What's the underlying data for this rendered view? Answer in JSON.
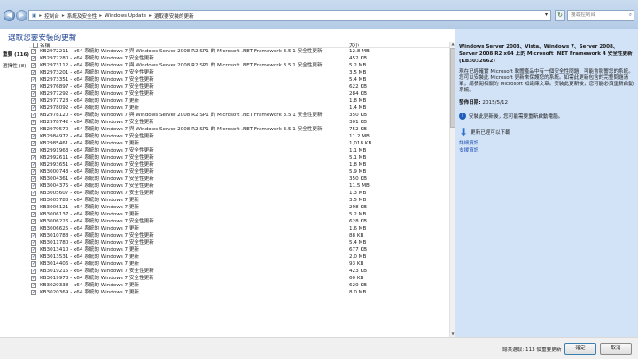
{
  "address": {
    "crumbs": [
      "控制台",
      "系統及安全性",
      "Windows Update",
      "選取要安裝的更新"
    ],
    "right_text": "",
    "search_placeholder": "搜尋控制台"
  },
  "heading": "選取您要安裝的更新",
  "categories": [
    {
      "label": "重要 (116)",
      "selected": true
    },
    {
      "label": "選擇性 (8)",
      "selected": false
    }
  ],
  "list": {
    "col_name": "名稱",
    "col_size": "大小",
    "rows": [
      {
        "name": "KB2972211 - x64 系統的 Windows 7 與 Windows Server 2008 R2 SP1 的 Microsoft .NET Framework 3.5.1 安全性更新",
        "size": "12.8 MB"
      },
      {
        "name": "KB2972280 - x64 系統的 Windows 7 安全性更新",
        "size": "452 KB"
      },
      {
        "name": "KB2973112 - x64 系統的 Windows 7 與 Windows Server 2008 R2 SP1 的 Microsoft .NET Framework 3.5.1 安全性更新",
        "size": "5.2 MB"
      },
      {
        "name": "KB2973201 - x64 系統的 Windows 7 安全性更新",
        "size": "3.5 MB"
      },
      {
        "name": "KB2973351 - x64 系統的 Windows 7 安全性更新",
        "size": "5.4 MB"
      },
      {
        "name": "KB2976897 - x64 系統的 Windows 7 安全性更新",
        "size": "622 KB"
      },
      {
        "name": "KB2977292 - x64 系統的 Windows 7 安全性更新",
        "size": "284 KB"
      },
      {
        "name": "KB2977728 - x64 系統的 Windows 7 更新",
        "size": "1.8 MB"
      },
      {
        "name": "KB2978092 - x64 系統的 Windows 7 更新",
        "size": "1.4 MB"
      },
      {
        "name": "KB2978120 - x64 系統的 Windows 7 與 Windows Server 2008 R2 SP1 的 Microsoft .NET Framework 3.5.1 安全性更新",
        "size": "350 KB"
      },
      {
        "name": "KB2978742 - x64 系統的 Windows 7 安全性更新",
        "size": "301 KB"
      },
      {
        "name": "KB2979570 - x64 系統的 Windows 7 與 Windows Server 2008 R2 SP1 的 Microsoft .NET Framework 3.5.1 安全性更新",
        "size": "752 KB"
      },
      {
        "name": "KB2984972 - x64 系統的 Windows 7 安全性更新",
        "size": "11.2 MB"
      },
      {
        "name": "KB2985461 - x64 系統的 Windows 7 更新",
        "size": "1,018 KB"
      },
      {
        "name": "KB2991963 - x64 系統的 Windows 7 安全性更新",
        "size": "1.1 MB"
      },
      {
        "name": "KB2992611 - x64 系統的 Windows 7 安全性更新",
        "size": "5.1 MB"
      },
      {
        "name": "KB2993651 - x64 系統的 Windows 7 安全性更新",
        "size": "1.8 MB"
      },
      {
        "name": "KB3000743 - x64 系統的 Windows 7 安全性更新",
        "size": "5.9 MB"
      },
      {
        "name": "KB3004361 - x64 系統的 Windows 7 安全性更新",
        "size": "350 KB"
      },
      {
        "name": "KB3004375 - x64 系統的 Windows 7 安全性更新",
        "size": "11.5 MB"
      },
      {
        "name": "KB3005607 - x64 系統的 Windows 7 安全性更新",
        "size": "1.3 MB"
      },
      {
        "name": "KB3005788 - x64 系統的 Windows 7 更新",
        "size": "3.5 MB"
      },
      {
        "name": "KB3006121 - x64 系統的 Windows 7 更新",
        "size": "298 KB"
      },
      {
        "name": "KB3006137 - x64 系統的 Windows 7 更新",
        "size": "5.2 MB"
      },
      {
        "name": "KB3006226 - x64 系統的 Windows 7 安全性更新",
        "size": "628 KB"
      },
      {
        "name": "KB3006625 - x64 系統的 Windows 7 更新",
        "size": "1.6 MB"
      },
      {
        "name": "KB3010788 - x64 系統的 Windows 7 安全性更新",
        "size": "88 KB"
      },
      {
        "name": "KB3011780 - x64 系統的 Windows 7 安全性更新",
        "size": "5.4 MB"
      },
      {
        "name": "KB3013410 - x64 系統的 Windows 7 更新",
        "size": "677 KB"
      },
      {
        "name": "KB3013531 - x64 系統的 Windows 7 更新",
        "size": "2.0 MB"
      },
      {
        "name": "KB3014406 - x64 系統的 Windows 7 更新",
        "size": "93 KB"
      },
      {
        "name": "KB3019215 - x64 系統的 Windows 7 安全性更新",
        "size": "423 KB"
      },
      {
        "name": "KB3019978 - x64 系統的 Windows 7 安全性更新",
        "size": "60 KB"
      },
      {
        "name": "KB3020338 - x64 系統的 Windows 7 更新",
        "size": "629 KB"
      },
      {
        "name": "KB3020369 - x64 系統的 Windows 7 更新",
        "size": "8.0 MB"
      }
    ]
  },
  "detail": {
    "title": "Windows Server 2003、Vista、Windows 7、Server 2008、Server 2008 R2 x64 上的 Microsoft .NET Framework 4 安全性更新 (KB3032662)",
    "body": "現在已經確實 Microsoft 軟體產品中有一個安全性問題，可能會影響您的系統。您可以安裝此 Microsoft 更新來保護您的系統。如需此更新包含的完整問題清單，請參閱相關的 Microsoft 知識庫文章。安裝此更新後，您可能必須重新啟動系統。",
    "date_label": "發佈日期:",
    "date_value": "2015/5/12",
    "restart_note": "安裝此更新後，您可能需要重新啟動電腦。",
    "download_note": "更新已經可以下載",
    "links": [
      "詳細資訊",
      "支援資訊"
    ]
  },
  "footer": {
    "total": "總共選取: 113 個重要更新",
    "ok": "確定",
    "cancel": "取消"
  }
}
